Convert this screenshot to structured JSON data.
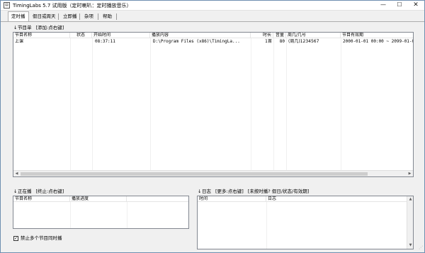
{
  "window": {
    "title": "TimingLabs 5.7 试用版（定时喇叭：定时播放音乐）",
    "icon": "app-icon",
    "min_label": "—",
    "max_label": "☐",
    "close_label": "✕"
  },
  "tabs": [
    {
      "label": "定时播"
    },
    {
      "label": "假日或周天"
    },
    {
      "label": "立即播"
    },
    {
      "label": "杂项"
    },
    {
      "label": "帮助"
    }
  ],
  "program_list": {
    "arrow": "↓",
    "title": "节目单",
    "hint": "[添加:点右键]",
    "columns": [
      "节目名称",
      "状态",
      "开始时间",
      "播放内容",
      "时长",
      "音量",
      "周几/几号",
      "节目有效期"
    ],
    "rows": [
      {
        "name": "上课",
        "status": "",
        "start": "08:37:11",
        "content": "D:\\Program Files (x86)\\TimingLa...",
        "duration": "1首",
        "volume": "80",
        "weekday": "(周几)1234567",
        "validity": "2000-01-01 00:00 ~ 2099-01-01"
      }
    ]
  },
  "now_playing": {
    "arrow": "↓",
    "title": "正在播",
    "hint": "[终止:点右键]",
    "columns": [
      "节目名称",
      "播放进度"
    ]
  },
  "log": {
    "arrow": "↓",
    "title": "日志",
    "hint": "[更多:点右键]",
    "hint2": "[未按时播? 假日/状态/有效期]",
    "columns": [
      "时间",
      "日志"
    ]
  },
  "options": {
    "prevent_multiple_label": "禁止多个节目同时播",
    "prevent_multiple_checked": true,
    "check_mark": "✓"
  },
  "scroll": {
    "left": "◀",
    "right": "▶",
    "up": "▲",
    "down": "▼"
  }
}
